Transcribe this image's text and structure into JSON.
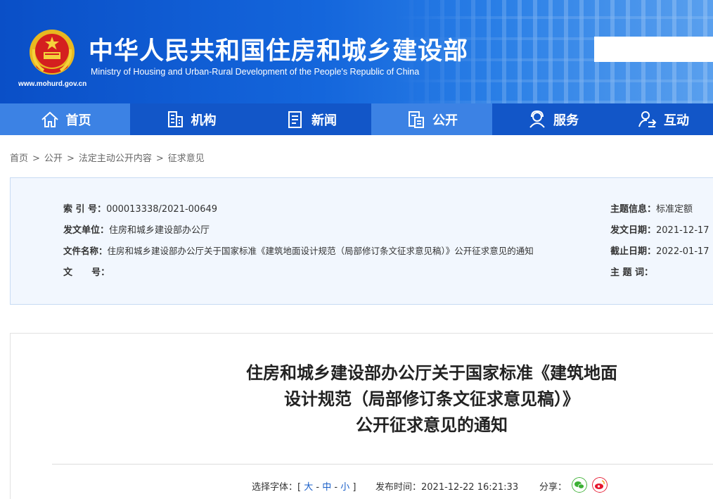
{
  "header": {
    "title": "中华人民共和国住房和城乡建设部",
    "subtitle": "Ministry of Housing and Urban-Rural Development of the People's Republic of China",
    "url": "www.mohurd.gov.cn",
    "search_value": ""
  },
  "nav": {
    "items": [
      {
        "label": "首页",
        "icon": "home-icon"
      },
      {
        "label": "机构",
        "icon": "building-icon"
      },
      {
        "label": "新闻",
        "icon": "news-icon"
      },
      {
        "label": "公开",
        "icon": "public-info-icon"
      },
      {
        "label": "服务",
        "icon": "service-icon"
      },
      {
        "label": "互动",
        "icon": "interaction-icon"
      }
    ]
  },
  "breadcrumb": [
    "首页",
    "公开",
    "法定主动公开内容",
    "征求意见"
  ],
  "info": {
    "index_label": "索 引 号：",
    "index_value": "000013338/2021-00649",
    "topic_label": "主题信息：",
    "topic_value": "标准定额",
    "issuer_label": "发文单位：",
    "issuer_value": "住房和城乡建设部办公厅",
    "date_label": "发文日期：",
    "date_value": "2021-12-17",
    "filename_label": "文件名称：",
    "filename_value": "住房和城乡建设部办公厅关于国家标准《建筑地面设计规范（局部修订条文征求意见稿）》公开征求意见的通知",
    "deadline_label": "截止日期：",
    "deadline_value": "2022-01-17",
    "docno_label": "文      号：",
    "docno_value": "",
    "keywords_label": "主 题 词：",
    "keywords_value": ""
  },
  "article": {
    "title_line1": "住房和城乡建设部办公厅关于国家标准《建筑地面",
    "title_line2": "设计规范（局部修订条文征求意见稿）》",
    "title_line3": "公开征求意见的通知",
    "font_label": "选择字体：[",
    "font_large": "大",
    "font_medium": "中",
    "font_small": "小",
    "font_close": "]",
    "publish_label": "发布时间：",
    "publish_time": "2021-12-22 16:21:33",
    "share_label": "分享："
  },
  "colors": {
    "header_blue": "#1256c8",
    "nav_light": "#3c82e4",
    "wechat_green": "#3cb034",
    "weibo_red": "#e6162d"
  }
}
